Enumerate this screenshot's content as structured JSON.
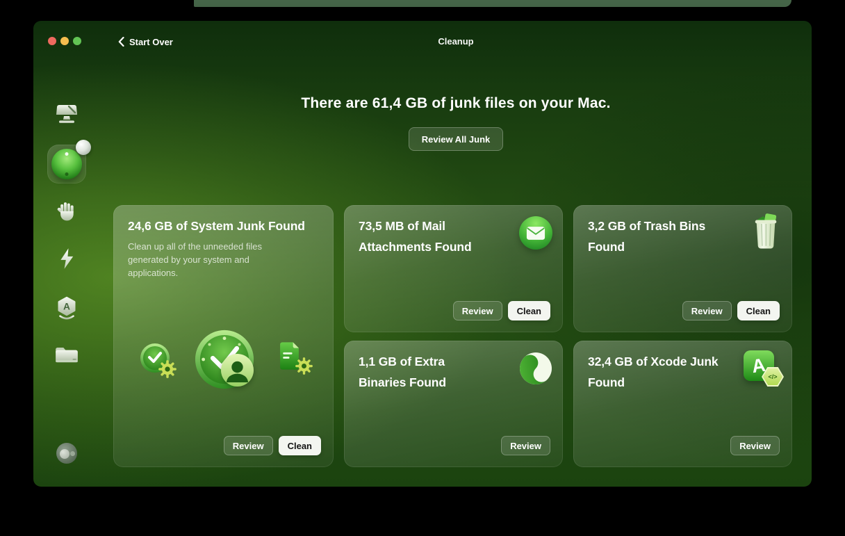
{
  "window": {
    "title": "Cleanup",
    "back_label": "Start Over"
  },
  "header": {
    "headline": "There are 61,4 GB of junk files on your Mac.",
    "review_all_label": "Review All Junk"
  },
  "sidebar": {
    "items": [
      {
        "id": "smart-care",
        "icon": "display-icon",
        "active": false
      },
      {
        "id": "cleanup",
        "icon": "cleanup-sphere-icon",
        "active": true,
        "has_badge": true
      },
      {
        "id": "protection",
        "icon": "hand-icon",
        "active": false
      },
      {
        "id": "performance",
        "icon": "lightning-icon",
        "active": false
      },
      {
        "id": "applications",
        "icon": "apps-hexagon-icon",
        "active": false
      },
      {
        "id": "my-clutter",
        "icon": "folder-icon",
        "active": false
      },
      {
        "id": "assistant",
        "icon": "assistant-icon",
        "active": false
      }
    ]
  },
  "cards": [
    {
      "id": "system-junk",
      "title": "24,6 GB of System Junk Found",
      "description": "Clean up all of the unneeded files generated by your system and applications.",
      "icons": [
        "clock-gear-icon",
        "clock-check-user-icon",
        "document-gear-icon"
      ],
      "review_label": "Review",
      "clean_label": "Clean"
    },
    {
      "id": "mail-attachments",
      "title": "73,5 MB of Mail Attachments Found",
      "icon": "mail-icon",
      "review_label": "Review",
      "clean_label": "Clean"
    },
    {
      "id": "trash-bins",
      "title": "3,2 GB of Trash Bins Found",
      "icon": "trash-icon",
      "review_label": "Review",
      "clean_label": "Clean"
    },
    {
      "id": "extra-binaries",
      "title": "1,1 GB of Extra Binaries Found",
      "icon": "binaries-icon",
      "review_label": "Review"
    },
    {
      "id": "xcode-junk",
      "title": "32,4 GB of Xcode Junk Found",
      "icon": "xcode-icon",
      "review_label": "Review"
    }
  ],
  "colors": {
    "window_bright_green": "#3e6a1e",
    "window_dark_green": "#0f2e0c",
    "clean_button_bg": "#f3f5f0",
    "clean_button_text": "#151515",
    "glass_button_bg": "rgba(255,255,255,0.13)",
    "accent_green": "#43b337",
    "traffic_close": "#ee6a5f",
    "traffic_min": "#f5bd4f",
    "traffic_zoom": "#62c454"
  }
}
